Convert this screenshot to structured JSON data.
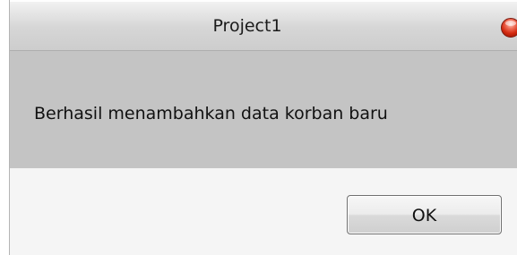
{
  "window": {
    "title": "Project1",
    "close_icon": "close-icon"
  },
  "message": {
    "text": "Berhasil menambahkan data korban baru"
  },
  "buttons": {
    "ok_label": "OK"
  }
}
